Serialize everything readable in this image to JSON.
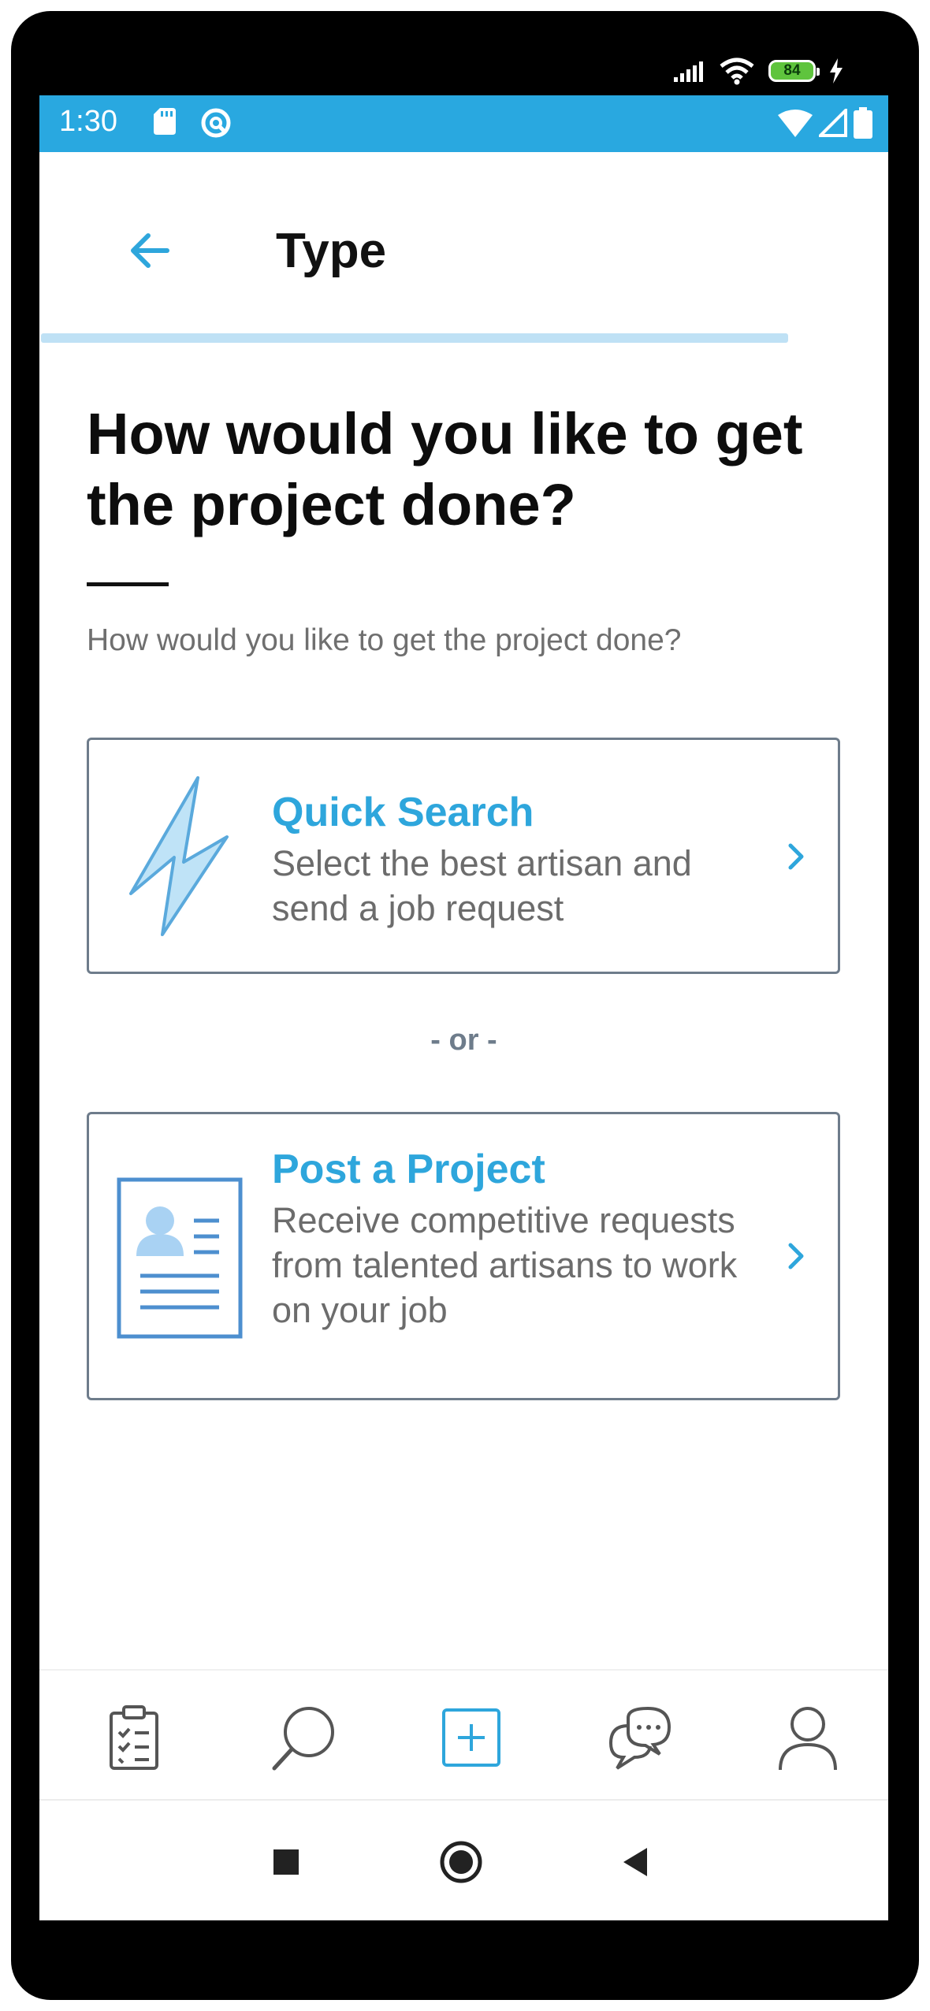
{
  "device": {
    "battery_level": "84"
  },
  "status_bar": {
    "time": "1:30",
    "color": "#29a8e0"
  },
  "app_bar": {
    "title": "Type",
    "back_icon": "arrow-left-icon"
  },
  "progress": {
    "value": 0.88
  },
  "page": {
    "heading": "How would you like to get the project done?",
    "subtitle": "How would you like to get the project done?",
    "separator": "- or -"
  },
  "options": {
    "quick_search": {
      "title": "Quick Search",
      "description": "Select the best artisan and send a job request",
      "icon": "lightning-bolt-icon"
    },
    "post_project": {
      "title": "Post a Project",
      "description": "Receive competitive requests from talented artisans to work on your job",
      "icon": "profile-document-icon"
    }
  },
  "bottom_nav": {
    "items": [
      {
        "icon": "clipboard-checklist-icon",
        "active": false
      },
      {
        "icon": "search-icon",
        "active": false
      },
      {
        "icon": "add-square-icon",
        "active": true
      },
      {
        "icon": "chat-bubbles-icon",
        "active": false
      },
      {
        "icon": "profile-icon",
        "active": false
      }
    ],
    "active_color": "#2ea6dc",
    "inactive_color": "#555555"
  },
  "accent_color": "#2ea6dc"
}
